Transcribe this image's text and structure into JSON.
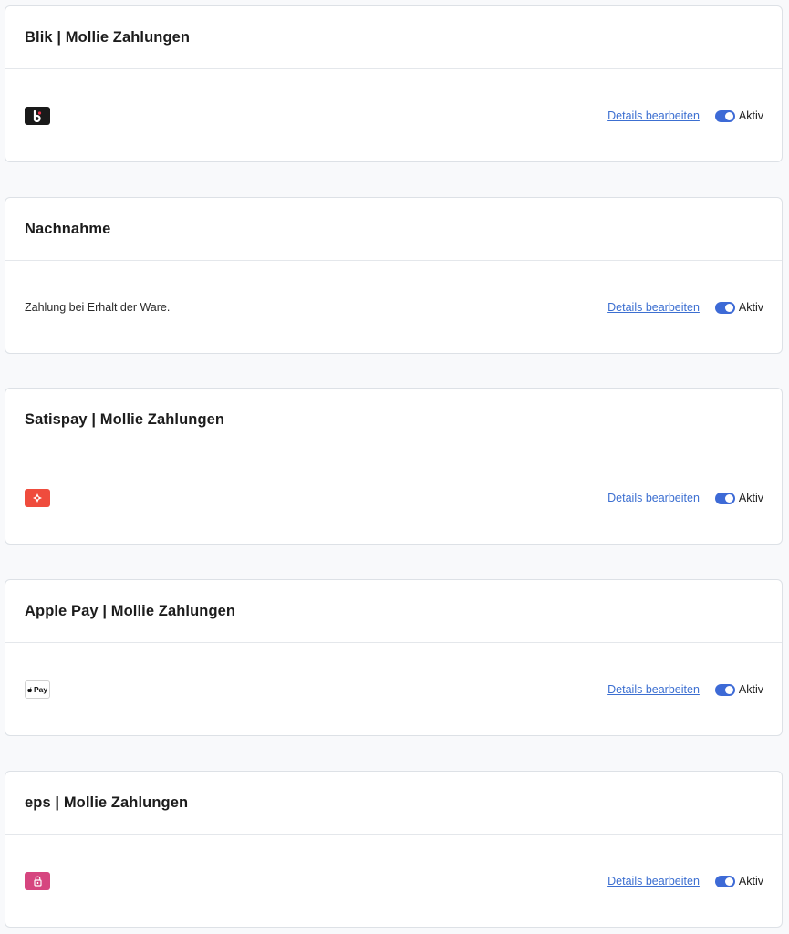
{
  "payment_methods": [
    {
      "title": "Blik | Mollie Zahlungen",
      "logo": "blik-logo-icon",
      "logo_color": "#1a1a1a",
      "edit_label": "Details bearbeiten",
      "status_label": "Aktiv",
      "active": true
    },
    {
      "title": "Nachnahme",
      "description": "Zahlung bei Erhalt der Ware.",
      "edit_label": "Details bearbeiten",
      "status_label": "Aktiv",
      "active": true
    },
    {
      "title": "Satispay | Mollie Zahlungen",
      "logo": "satispay-logo-icon",
      "logo_color": "#ef4c3d",
      "edit_label": "Details bearbeiten",
      "status_label": "Aktiv",
      "active": true
    },
    {
      "title": "Apple Pay | Mollie Zahlungen",
      "logo": "apple-pay-logo-icon",
      "logo_text": "Pay",
      "edit_label": "Details bearbeiten",
      "status_label": "Aktiv",
      "active": true
    },
    {
      "title": "eps | Mollie Zahlungen",
      "logo": "eps-logo-icon",
      "logo_color": "#d6457f",
      "edit_label": "Details bearbeiten",
      "status_label": "Aktiv",
      "active": true
    }
  ],
  "colors": {
    "accent": "#3d6ad6",
    "link": "#3c6fd1"
  }
}
